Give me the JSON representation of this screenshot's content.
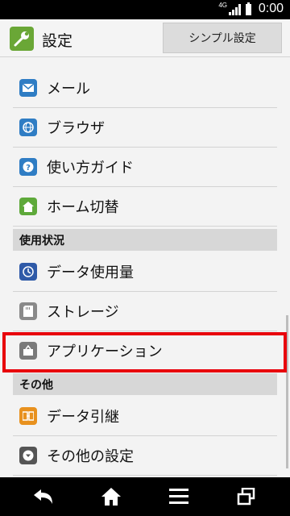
{
  "status": {
    "network": "4G",
    "time": "0:00"
  },
  "header": {
    "title": "設定",
    "simple_settings": "シンプル設定"
  },
  "list": {
    "item_mail": "メール",
    "item_browser": "ブラウザ",
    "item_guide": "使い方ガイド",
    "item_home": "ホーム切替",
    "section_usage": "使用状況",
    "item_data_usage": "データ使用量",
    "item_storage": "ストレージ",
    "item_apps": "アプリケーション",
    "section_other": "その他",
    "item_data_transfer": "データ引継",
    "item_other_settings": "その他の設定"
  },
  "colors": {
    "accent_blue": "#2f7dc4",
    "highlight": "#e8000b",
    "app_icon_green": "#6aa736"
  }
}
